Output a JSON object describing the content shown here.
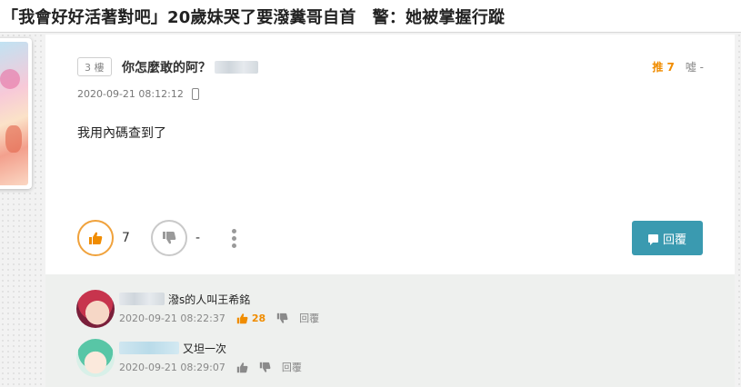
{
  "header": {
    "title": "「我會好好活著對吧」20歲妹哭了要潑糞哥自首　警：她被掌握行蹤"
  },
  "post": {
    "floor": "3 樓",
    "author_text": "你怎麼敢的阿？",
    "push_label": "推 7",
    "boo_label": "噓 -",
    "timestamp": "2020-09-21 08:12:12",
    "content": "我用內碼查到了",
    "like_count": "7",
    "dislike_count": "-",
    "reply_label": "回覆"
  },
  "comments": [
    {
      "text": "潑s的人叫王希銘",
      "timestamp": "2020-09-21 08:22:37",
      "like_count": "28",
      "reply_label": "回覆"
    },
    {
      "text": "又坦一次",
      "timestamp": "2020-09-21 08:29:07",
      "reply_label": "回覆"
    }
  ],
  "colors": {
    "accent_orange": "#f08c00",
    "reply_button": "#3a9ab0",
    "comments_bg": "#eef0ee"
  },
  "icons": [
    "thumb-up-icon",
    "thumb-down-icon",
    "more-vertical-icon",
    "phone-icon",
    "chat-bubble-icon"
  ]
}
